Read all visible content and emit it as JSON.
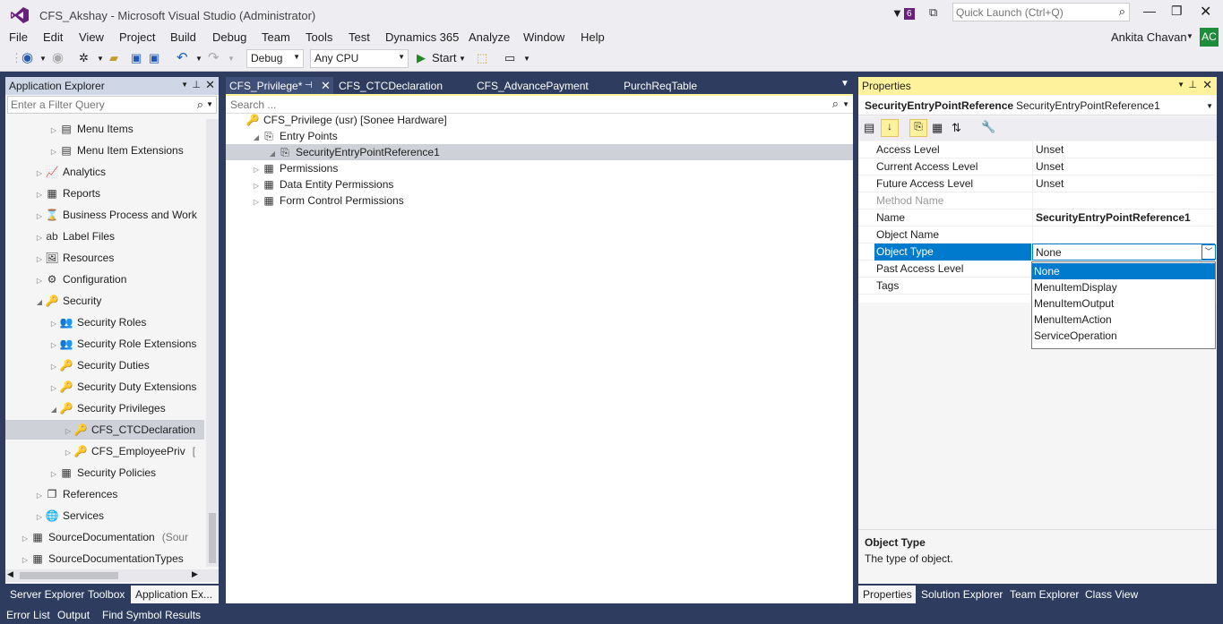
{
  "window": {
    "title": "CFS_Akshay - Microsoft Visual Studio (Administrator)",
    "notification_count": "6",
    "quick_launch_placeholder": "Quick Launch (Ctrl+Q)",
    "user_name": "Ankita Chavan",
    "user_initials": "AC"
  },
  "menu": [
    "File",
    "Edit",
    "View",
    "Project",
    "Build",
    "Debug",
    "Team",
    "Tools",
    "Test",
    "Dynamics 365",
    "Analyze",
    "Window",
    "Help"
  ],
  "toolbar": {
    "config": "Debug",
    "platform": "Any CPU",
    "start_label": "Start"
  },
  "app_explorer": {
    "title": "Application Explorer",
    "filter_placeholder": "Enter a Filter Query",
    "items": [
      {
        "label": "Menu Items",
        "indent": 3,
        "icon": "▤",
        "expand": "▷"
      },
      {
        "label": "Menu Item Extensions",
        "indent": 3,
        "icon": "▤",
        "expand": "▷"
      },
      {
        "label": "Analytics",
        "indent": 2,
        "icon": "📈",
        "expand": "▷"
      },
      {
        "label": "Reports",
        "indent": 2,
        "icon": "▦",
        "expand": "▷"
      },
      {
        "label": "Business Process and Work",
        "indent": 2,
        "icon": "⌛",
        "expand": "▷"
      },
      {
        "label": "Label Files",
        "indent": 2,
        "icon": "ab",
        "expand": "▷"
      },
      {
        "label": "Resources",
        "indent": 2,
        "icon": "🖼",
        "expand": "▷"
      },
      {
        "label": "Configuration",
        "indent": 2,
        "icon": "⚙",
        "expand": "▷"
      },
      {
        "label": "Security",
        "indent": 2,
        "icon": "🔑",
        "expand": "◢"
      },
      {
        "label": "Security Roles",
        "indent": 3,
        "icon": "👥",
        "expand": "▷"
      },
      {
        "label": "Security Role Extensions",
        "indent": 3,
        "icon": "👥",
        "expand": "▷"
      },
      {
        "label": "Security Duties",
        "indent": 3,
        "icon": "🔑",
        "expand": "▷"
      },
      {
        "label": "Security Duty Extensions",
        "indent": 3,
        "icon": "🔑",
        "expand": "▷"
      },
      {
        "label": "Security Privileges",
        "indent": 3,
        "icon": "🔑",
        "expand": "◢"
      },
      {
        "label": "CFS_CTCDeclaration",
        "indent": 4,
        "icon": "🔑",
        "expand": "▷",
        "selected": true
      },
      {
        "label": "CFS_EmployeePriv",
        "indent": 4,
        "icon": "🔑",
        "expand": "▷",
        "suffix": "["
      },
      {
        "label": "Security Policies",
        "indent": 3,
        "icon": "▦",
        "expand": "▷"
      },
      {
        "label": "References",
        "indent": 2,
        "icon": "❐",
        "expand": "▷"
      },
      {
        "label": "Services",
        "indent": 2,
        "icon": "🌐",
        "expand": "▷"
      },
      {
        "label": "SourceDocumentation",
        "indent": 1,
        "icon": "▦",
        "expand": "▷",
        "suffix": "(Sour"
      },
      {
        "label": "SourceDocumentationTypes",
        "indent": 1,
        "icon": "▦",
        "expand": "▷"
      }
    ]
  },
  "doc_tabs": [
    "CFS_Privilege*",
    "CFS_CTCDeclaration",
    "CFS_AdvancePayment",
    "PurchReqTable"
  ],
  "designer": {
    "search_placeholder": "Search ...",
    "nodes": [
      {
        "label": "CFS_Privilege (usr) [Sonee Hardware]",
        "indent": 0,
        "expand": "",
        "icon": "🔑"
      },
      {
        "label": "Entry Points",
        "indent": 1,
        "expand": "◢",
        "icon": "⎘"
      },
      {
        "label": "SecurityEntryPointReference1",
        "indent": 2,
        "expand": "◢",
        "icon": "⎘",
        "selected": true
      },
      {
        "label": "Permissions",
        "indent": 1,
        "expand": "▷",
        "icon": "▦"
      },
      {
        "label": "Data Entity Permissions",
        "indent": 1,
        "expand": "▷",
        "icon": "▦"
      },
      {
        "label": "Form Control Permissions",
        "indent": 1,
        "expand": "▷",
        "icon": "▦"
      }
    ]
  },
  "properties": {
    "title": "Properties",
    "object_type_name": "SecurityEntryPointReference",
    "object_name": "SecurityEntryPointReference1",
    "rows": [
      {
        "name": "Access Level",
        "value": "Unset"
      },
      {
        "name": "Current Access Level",
        "value": "Unset"
      },
      {
        "name": "Future Access Level",
        "value": "Unset"
      },
      {
        "name": "Method Name",
        "value": "",
        "disabled": true
      },
      {
        "name": "Name",
        "value": "SecurityEntryPointReference1",
        "bold": true
      },
      {
        "name": "Object Name",
        "value": ""
      },
      {
        "name": "Object Type",
        "value": "None",
        "selected": true
      },
      {
        "name": "Past Access Level",
        "value": ""
      },
      {
        "name": "Tags",
        "value": ""
      }
    ],
    "dropdown_options": [
      "None",
      "MenuItemDisplay",
      "MenuItemOutput",
      "MenuItemAction",
      "ServiceOperation"
    ],
    "description_title": "Object Type",
    "description_text": "The type of object."
  },
  "left_bottom_tabs": [
    "Server Explorer",
    "Toolbox",
    "Application Ex..."
  ],
  "right_bottom_tabs": [
    "Properties",
    "Solution Explorer",
    "Team Explorer",
    "Class View"
  ],
  "status_tabs": [
    "Error List",
    "Output",
    "Find Symbol Results"
  ],
  "colors": {
    "accent": "#007acc",
    "selected_row": "#cfd1d9",
    "frame": "#2d3c5f",
    "header_active": "#fff29d",
    "avatar_bg": "#1c8d3a"
  }
}
